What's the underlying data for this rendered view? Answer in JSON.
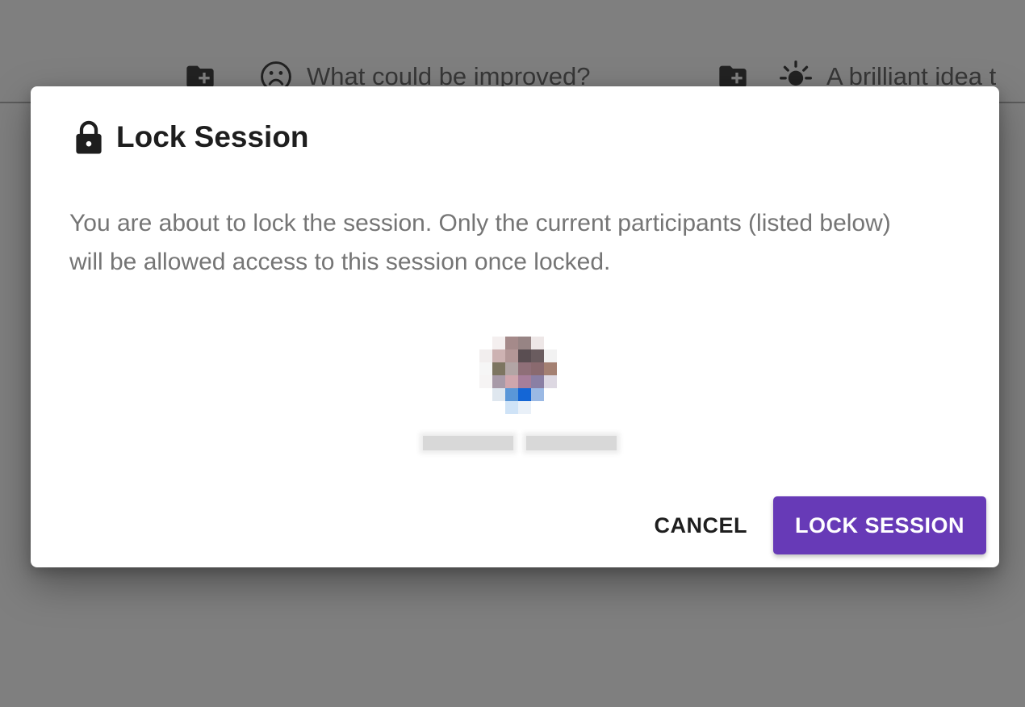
{
  "background": {
    "columns": [
      {
        "icon": "create-new-folder-icon",
        "mood_icon": "sad-face-icon",
        "title": "What could be improved?"
      },
      {
        "icon": "create-new-folder-icon",
        "mood_icon": "sun-icon",
        "title": "A brilliant idea t"
      }
    ]
  },
  "dialog": {
    "icon": "lock-icon",
    "title": "Lock Session",
    "body": "You are about to lock the session. Only the current participants (listed below) will be allowed access to this session once locked.",
    "participant": {
      "avatar": "pixelated-avatar",
      "name": ""
    },
    "actions": {
      "cancel_label": "CANCEL",
      "confirm_label": "LOCK SESSION"
    }
  },
  "colors": {
    "primary": "#673ab7",
    "scrim": "rgba(0,0,0,0.5)"
  }
}
